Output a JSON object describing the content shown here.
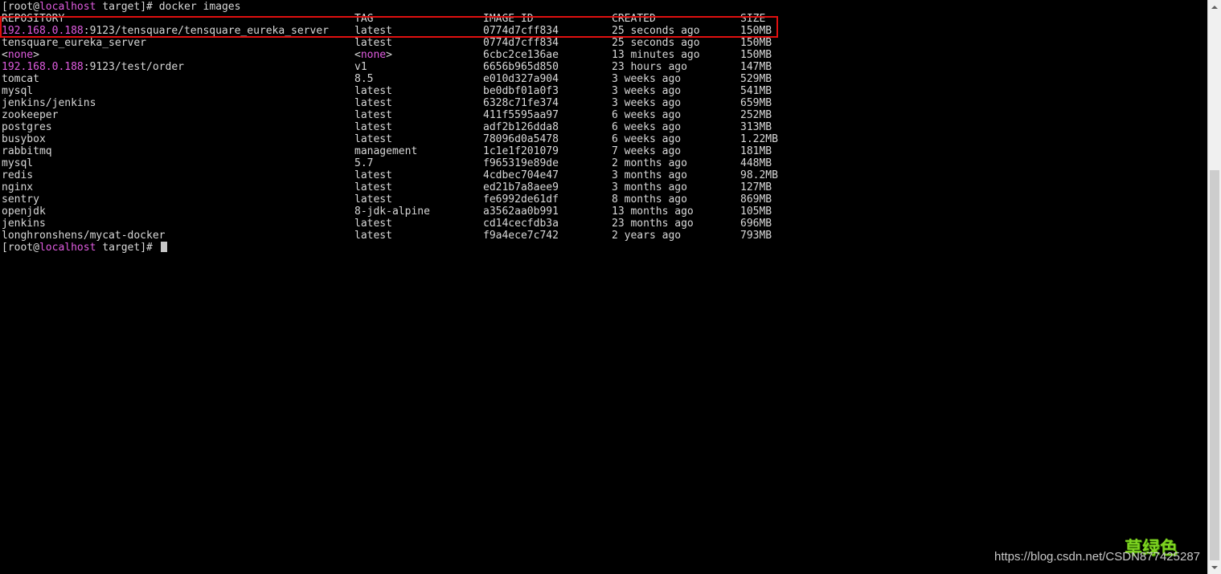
{
  "prompt_top": {
    "bracket_open": "[root@",
    "host": "localhost",
    "rest": " target]# ",
    "command": "docker images"
  },
  "headers": {
    "repository": "REPOSITORY",
    "tag": "TAG",
    "image_id": "IMAGE ID",
    "created": "CREATED",
    "size": "SIZE"
  },
  "rows": [
    {
      "repo_prefix": "192.168.0.188",
      "repo_rest": ":9123/tensquare/tensquare_eureka_server",
      "tag": "latest",
      "image_id": "0774d7cff834",
      "created": "25 seconds ago",
      "size": "150MB"
    },
    {
      "repo_prefix": "",
      "repo_rest": "tensquare_eureka_server",
      "tag": "latest",
      "image_id": "0774d7cff834",
      "created": "25 seconds ago",
      "size": "150MB"
    },
    {
      "repo_lt": "<",
      "repo_none": "none",
      "repo_gt": ">",
      "tag_lt": "<",
      "tag_none": "none",
      "tag_gt": ">",
      "image_id": "6cbc2ce136ae",
      "created": "13 minutes ago",
      "size": "150MB"
    },
    {
      "repo_prefix": "192.168.0.188",
      "repo_rest": ":9123/test/order",
      "tag": "v1",
      "image_id": "6656b965d850",
      "created": "23 hours ago",
      "size": "147MB"
    },
    {
      "repo_prefix": "",
      "repo_rest": "tomcat",
      "tag": "8.5",
      "image_id": "e010d327a904",
      "created": "3 weeks ago",
      "size": "529MB"
    },
    {
      "repo_prefix": "",
      "repo_rest": "mysql",
      "tag": "latest",
      "image_id": "be0dbf01a0f3",
      "created": "3 weeks ago",
      "size": "541MB"
    },
    {
      "repo_prefix": "",
      "repo_rest": "jenkins/jenkins",
      "tag": "latest",
      "image_id": "6328c71fe374",
      "created": "3 weeks ago",
      "size": "659MB"
    },
    {
      "repo_prefix": "",
      "repo_rest": "zookeeper",
      "tag": "latest",
      "image_id": "411f5595aa97",
      "created": "6 weeks ago",
      "size": "252MB"
    },
    {
      "repo_prefix": "",
      "repo_rest": "postgres",
      "tag": "latest",
      "image_id": "adf2b126dda8",
      "created": "6 weeks ago",
      "size": "313MB"
    },
    {
      "repo_prefix": "",
      "repo_rest": "busybox",
      "tag": "latest",
      "image_id": "78096d0a5478",
      "created": "6 weeks ago",
      "size": "1.22MB"
    },
    {
      "repo_prefix": "",
      "repo_rest": "rabbitmq",
      "tag": "management",
      "image_id": "1c1e1f201079",
      "created": "7 weeks ago",
      "size": "181MB"
    },
    {
      "repo_prefix": "",
      "repo_rest": "mysql",
      "tag": "5.7",
      "image_id": "f965319e89de",
      "created": "2 months ago",
      "size": "448MB"
    },
    {
      "repo_prefix": "",
      "repo_rest": "redis",
      "tag": "latest",
      "image_id": "4cdbec704e47",
      "created": "3 months ago",
      "size": "98.2MB"
    },
    {
      "repo_prefix": "",
      "repo_rest": "nginx",
      "tag": "latest",
      "image_id": "ed21b7a8aee9",
      "created": "3 months ago",
      "size": "127MB"
    },
    {
      "repo_prefix": "",
      "repo_rest": "sentry",
      "tag": "latest",
      "image_id": "fe6992de61df",
      "created": "8 months ago",
      "size": "869MB"
    },
    {
      "repo_prefix": "",
      "repo_rest": "openjdk",
      "tag": "8-jdk-alpine",
      "image_id": "a3562aa0b991",
      "created": "13 months ago",
      "size": "105MB"
    },
    {
      "repo_prefix": "",
      "repo_rest": "jenkins",
      "tag": "latest",
      "image_id": "cd14cecfdb3a",
      "created": "23 months ago",
      "size": "696MB"
    },
    {
      "repo_prefix": "",
      "repo_rest": "longhronshens/mycat-docker",
      "tag": "latest",
      "image_id": "f9a4ece7c742",
      "created": "2 years ago",
      "size": "793MB"
    }
  ],
  "prompt_bottom": {
    "bracket_open": "[root@",
    "host": "localhost",
    "rest": " target]# "
  },
  "watermark": {
    "text": "https://blog.csdn.net/CSDN877425287",
    "stamp": "草绿色"
  },
  "colors": {
    "background": "#000000",
    "text": "#d8d8d8",
    "host_magenta": "#e05ce0",
    "highlight_box": "#e01010"
  }
}
